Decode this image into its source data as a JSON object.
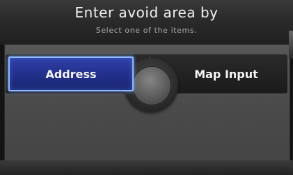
{
  "header": {
    "title": "Enter avoid area by",
    "subtitle": "Select one of the items."
  },
  "options": {
    "address_label": "Address",
    "map_input_label": "Map Input",
    "selected": "Address"
  },
  "colors": {
    "selected_fill": "#23318c",
    "selected_border": "#8fb9ff",
    "panel_bg": "#4f4f4f"
  }
}
